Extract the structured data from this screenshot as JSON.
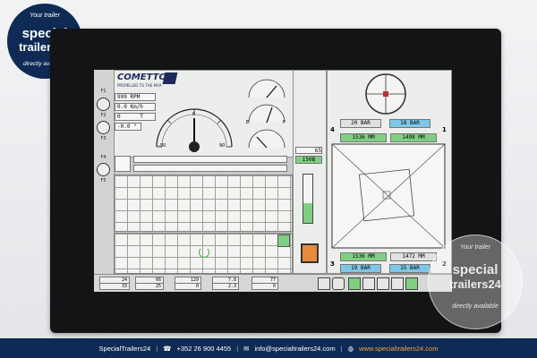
{
  "brand": {
    "top_text": "Your trailer",
    "name_line1": "special",
    "name_line2": "trailers24",
    "bottom_text": "directly available"
  },
  "hmi": {
    "logo": "COMETTO",
    "tagline": "PROPELLED TO THE MAX",
    "fkeys": [
      "F1",
      "F2",
      "F3",
      "F4",
      "F5"
    ],
    "readouts": [
      {
        "value": "999",
        "unit": "RPM"
      },
      {
        "value": "0.0",
        "unit": "Km/h"
      },
      {
        "value": "0",
        "unit": "T"
      },
      {
        "value": "-0.0",
        "unit": "°"
      }
    ],
    "speedo": {
      "min_label": "-90",
      "max_label": "90",
      "top_label": "0",
      "needle_value": 0
    },
    "small_gauge_labels": {
      "e": "E",
      "f": "F"
    },
    "side_values": {
      "value1": "65",
      "value2": "150B"
    },
    "pressure": {
      "label_left": "4",
      "label_right": "1",
      "label_bottom_left": "3",
      "label_bottom_right": "2",
      "top_left": "20 BAR",
      "top_right": "18 BAR",
      "bottom_left": "19 BAR",
      "bottom_right": "15 BAR"
    },
    "stroke": {
      "top_left": "1536 MM",
      "top_right": "1498 MM",
      "bottom_left": "1536 MM",
      "bottom_right": "1472 MM"
    },
    "bottom_row": [
      {
        "a": "24",
        "b": "33"
      },
      {
        "a": "66",
        "b": "25"
      },
      {
        "a": "129",
        "b": "0"
      },
      {
        "a": "7.8",
        "b": "2.3"
      },
      {
        "a": "77",
        "b": "0"
      }
    ]
  },
  "footer": {
    "brand": "SpecialTrailers24",
    "phone": "+352 26 900 4455",
    "email": "info@specialtrailers24.com",
    "website": "www.specialtrailers24.com"
  },
  "colors": {
    "navy": "#0f2b55",
    "accent": "#f3a43b",
    "lcd_green": "#7fcf83",
    "lcd_blue": "#7fc7e6"
  }
}
